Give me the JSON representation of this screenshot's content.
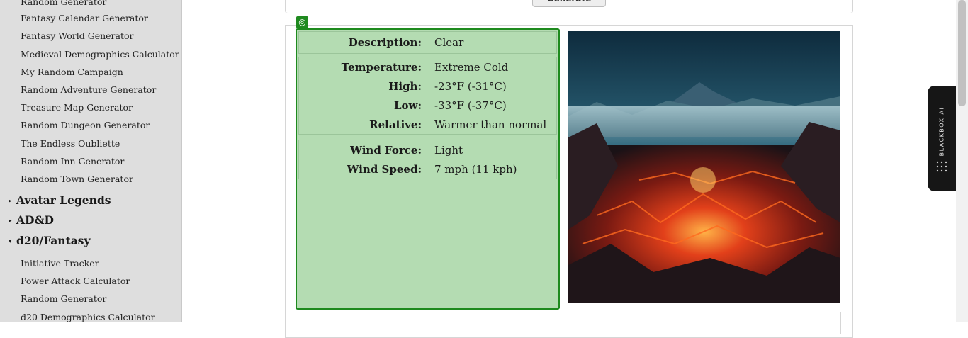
{
  "sidebar": {
    "links_top": [
      "Random Generator",
      "Fantasy Calendar Generator",
      "Fantasy World Generator",
      "Medieval Demographics Calculator",
      "My Random Campaign",
      "Random Adventure Generator",
      "Treasure Map Generator",
      "Random Dungeon Generator",
      "The Endless Oubliette",
      "Random Inn Generator",
      "Random Town Generator"
    ],
    "categories": [
      {
        "label": "Avatar Legends",
        "state": "collapsed"
      },
      {
        "label": "AD&D",
        "state": "collapsed"
      },
      {
        "label": "d20/Fantasy",
        "state": "expanded"
      }
    ],
    "links_d20": [
      "Initiative Tracker",
      "Power Attack Calculator",
      "Random Generator",
      "d20 Demographics Calculator"
    ]
  },
  "generate_button": "Generate",
  "weather": {
    "description": {
      "label": "Description:",
      "value": "Clear"
    },
    "temperature": {
      "label": "Temperature:",
      "value": "Extreme Cold"
    },
    "high": {
      "label": "High:",
      "value": "-23°F (-31°C)"
    },
    "low": {
      "label": "Low:",
      "value": "-33°F (-37°C)"
    },
    "relative": {
      "label": "Relative:",
      "value": "Warmer than normal"
    },
    "wind_force": {
      "label": "Wind Force:",
      "value": "Light"
    },
    "wind_speed": {
      "label": "Wind Speed:",
      "value": "7 mph (11 kph)"
    }
  },
  "icons": {
    "pin": "target-icon",
    "ai": "blackbox-logo-icon"
  },
  "ai_tab": {
    "label": "BLACKBOX AI"
  },
  "colors": {
    "card_bg": "#b4dcb2",
    "card_border": "#1e8a1e",
    "sidebar_bg": "#dedede"
  }
}
